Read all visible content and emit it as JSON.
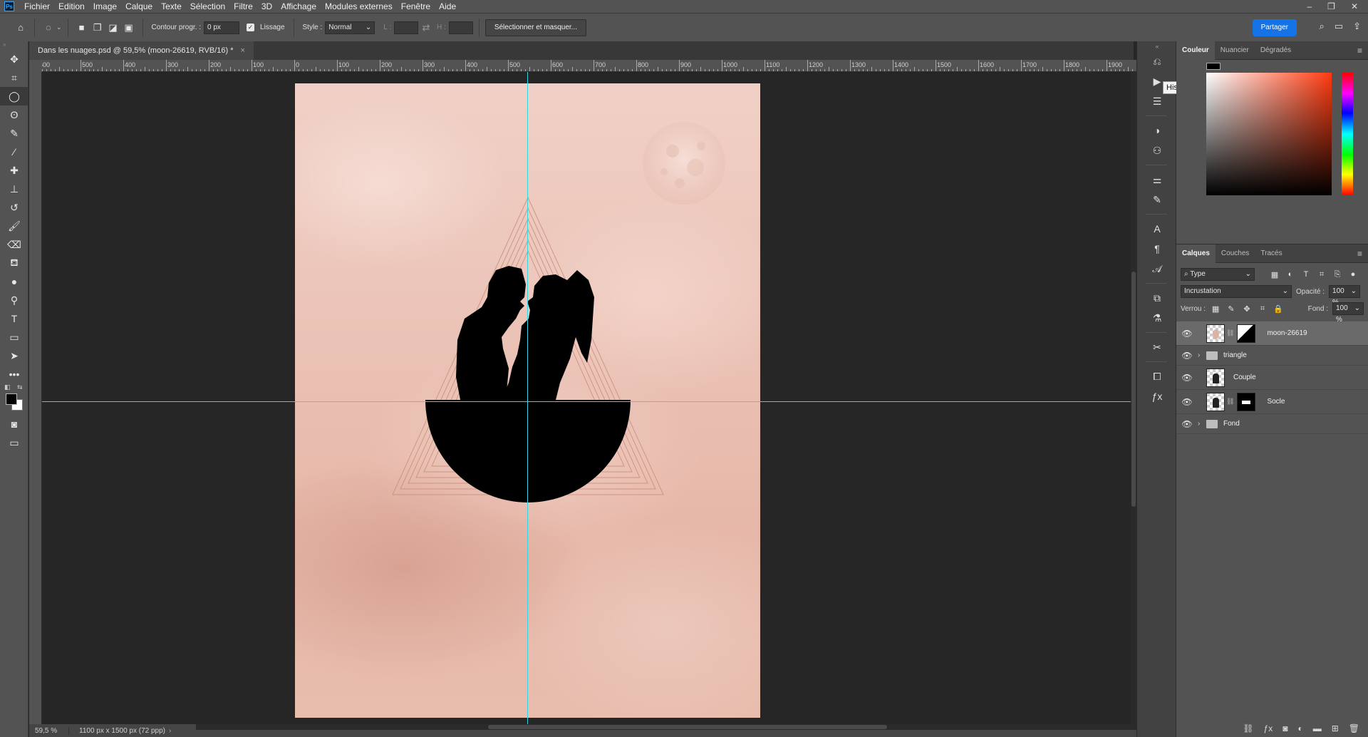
{
  "menu": {
    "logo": "Ps",
    "items": [
      "Fichier",
      "Edition",
      "Image",
      "Calque",
      "Texte",
      "Sélection",
      "Filtre",
      "3D",
      "Affichage",
      "Modules externes",
      "Fenêtre",
      "Aide"
    ]
  },
  "options": {
    "feather_label": "Contour progr. :",
    "feather_value": "0 px",
    "antialias_label": "Lissage",
    "style_label": "Style :",
    "style_value": "Normal",
    "width_label": "L :",
    "height_label": "H :",
    "select_mask_label": "Sélectionner et masquer...",
    "share_label": "Partager"
  },
  "document": {
    "tab_title": "Dans les nuages.psd @ 59,5% (moon-26619, RVB/16) *",
    "close_glyph": "×"
  },
  "ruler": {
    "labels": [
      "600",
      "500",
      "400",
      "300",
      "200",
      "100",
      "0",
      "100",
      "200",
      "300",
      "400",
      "500",
      "600",
      "700",
      "800",
      "900",
      "1000",
      "1100",
      "1200",
      "1300",
      "1400",
      "1500",
      "1600",
      "1700",
      "1800",
      "1900"
    ]
  },
  "status": {
    "zoom": "59,5 %",
    "doc_info": "1100 px x 1500 px (72 ppp)"
  },
  "tooltip": "Historique",
  "color_panel": {
    "tabs": [
      "Couleur",
      "Nuancier",
      "Dégradés"
    ]
  },
  "layers_panel": {
    "tabs": [
      "Calques",
      "Couches",
      "Tracés"
    ],
    "filter_value": "Type",
    "blend_mode": "Incrustation",
    "opacity_label": "Opacité :",
    "opacity_value": "100 %",
    "lock_label": "Verrou :",
    "fill_label": "Fond :",
    "fill_value": "100 %",
    "layers": [
      {
        "name": "moon-26619",
        "type": "layer-mask",
        "selected": true
      },
      {
        "name": "triangle",
        "type": "group",
        "selected": false
      },
      {
        "name": "Couple",
        "type": "layer",
        "selected": false
      },
      {
        "name": "Socle",
        "type": "layer-mask",
        "selected": false
      },
      {
        "name": "Fond",
        "type": "group",
        "selected": false
      }
    ]
  },
  "colors": {
    "guide": "#34d6e0",
    "accent": "#1473e6",
    "silhouette": "#000000"
  }
}
